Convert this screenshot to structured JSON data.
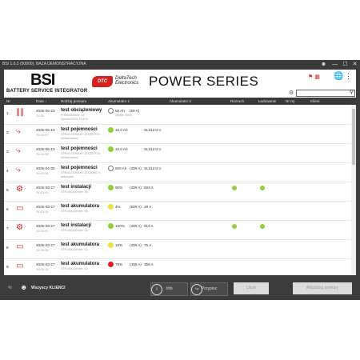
{
  "window": {
    "title": "BSI 1.0.2 (50800), BAZA DEMONSTRACYJNA",
    "controls": {
      "minimize": "—",
      "maximize": "☐",
      "close": "✕"
    }
  },
  "header": {
    "brand": "BSI",
    "subtitle": "BATTERY SERVICE INTEGRATOR",
    "logo_text": "DTC",
    "company": "DeltaTech\nElectronics",
    "product": "POWER SERIES",
    "search": {
      "placeholder": "",
      "value": ""
    }
  },
  "columns": [
    "Nr",
    "Data",
    "Rodzaj pomiaru",
    "Akumulator 1",
    "Akumulator 2",
    "Rozruch",
    "Ładowanie",
    "Nr rej",
    "Klient"
  ],
  "rows": [
    {
      "nr": "1",
      "icon": "load-test-icon",
      "date": "2025-05-23",
      "time": "11:16",
      "type": "test obciążeniowy",
      "s1": "PrSNAS/Nom: 14",
      "s2": "Szrenz/2025 11/4h3",
      "ind": "empty",
      "a1": "50 Ah",
      "a2": "(59 A)",
      "a3": "",
      "a1sub": "Nome: 0505",
      "start": false,
      "charge": false
    },
    {
      "nr": "2",
      "icon": "probe-icon",
      "date": "2025-05-13",
      "time": "15:40:57",
      "type": "test pojemności",
      "s1": "DTB01102/Nom: 3212D7TU7",
      "s2": "niedatowane",
      "ind": "green",
      "a1": "15.0 Ah",
      "a2": "",
      "a3": "SLI/12.0 V",
      "a1sub": "",
      "start": false,
      "charge": false
    },
    {
      "nr": "3",
      "icon": "probe-icon",
      "date": "2025-05-13",
      "time": "15:44:08",
      "type": "test pojemności",
      "s1": "DTB01102/Nom: 3212D7TU8",
      "s2": "niedatowane",
      "ind": "green",
      "a1": "10.0 Ah",
      "a2": "",
      "a3": "SLI/12.0 V",
      "a1sub": "",
      "start": false,
      "charge": false
    },
    {
      "nr": "4",
      "icon": "probe-icon",
      "date": "2025-04-30",
      "time": "10:43:34",
      "type": "test pojemności",
      "s1": "DTB01102/Nom: 3212B9BTS",
      "s2": "ładowane",
      "ind": "empty",
      "a1": "500 Ah",
      "a2": "(400 A)",
      "a3": "SLI/12.0 V",
      "a1sub": "",
      "start": false,
      "charge": false
    },
    {
      "nr": "5",
      "icon": "gear-icon",
      "date": "2025-03-27",
      "time": "15:13:43",
      "type": "test instalacji",
      "s1": "DTE05023/Nom: 35",
      "s2": "",
      "ind": "green",
      "a1": "90%",
      "a2": "(400 A)",
      "a3": "593 A",
      "a1sub": "",
      "start": true,
      "charge": true
    },
    {
      "nr": "6",
      "icon": "battery-icon",
      "date": "2025-03-27",
      "time": "15:13:24",
      "type": "test akumulatora",
      "s1": "DTE05023/Nom: 35",
      "s2": "",
      "ind": "yellow",
      "a1": "4%",
      "a2": "(500 A)",
      "a3": "28 A",
      "a1sub": "",
      "start": false,
      "charge": false
    },
    {
      "nr": "7",
      "icon": "gear-icon",
      "date": "2025-03-27",
      "time": "12:33:51",
      "type": "test instalacji",
      "s1": "DTE05023/Nom: 34",
      "s2": "",
      "ind": "green",
      "a1": "100%",
      "a2": "(400 A)",
      "a3": "613 A",
      "a1sub": "",
      "start": true,
      "charge": true
    },
    {
      "nr": "8",
      "icon": "battery-icon",
      "date": "2025-03-27",
      "time": "12:29:08",
      "type": "test akumulatora",
      "s1": "DTE05023/Nom: 33",
      "s2": "",
      "ind": "yellow",
      "a1": "16%",
      "a2": "(400 A)",
      "a3": "75 A",
      "a1sub": "",
      "start": false,
      "charge": false
    },
    {
      "nr": "9",
      "icon": "battery-icon",
      "date": "2025-03-27",
      "time": "10:05:19",
      "type": "test akumulatora",
      "s1": "DTE05023/Nom: 32",
      "s2": "",
      "ind": "red",
      "a1": "79%",
      "a2": "(450 A)",
      "a3": "359 A",
      "a1sub": "",
      "start": false,
      "charge": false
    }
  ],
  "footer": {
    "clients_label": "Wszyscy KLIENCI",
    "info": "Info",
    "przypisz": "Przypisz",
    "usun": "Usuń",
    "aktualizuj": "Aktualizuj pomiary"
  },
  "colors": {
    "green": "#8fd13a",
    "yellow": "#e8e23a",
    "red": "#d62020",
    "accent": "#d62020"
  }
}
